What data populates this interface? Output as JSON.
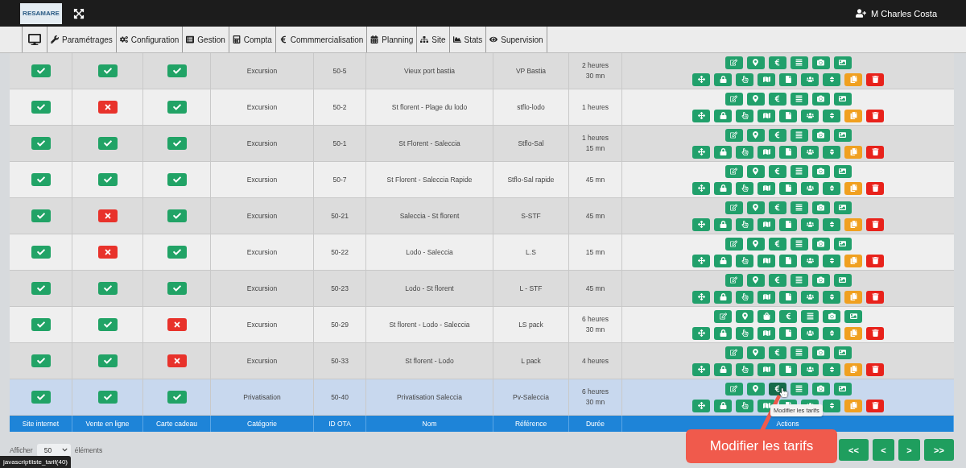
{
  "top_bar": {
    "logo": "RESAMARE",
    "user": "M Charles Costa"
  },
  "menu": [
    {
      "kind": "desktop"
    },
    {
      "kind": "wrench",
      "label": "Paramétrages"
    },
    {
      "kind": "cogs",
      "label": "Configuration"
    },
    {
      "kind": "list",
      "label": "Gestion"
    },
    {
      "kind": "calculator",
      "label": "Compta"
    },
    {
      "kind": "euro",
      "label": "Commmercialisation"
    },
    {
      "kind": "calendar",
      "label": "Planning"
    },
    {
      "kind": "sitemap",
      "label": "Site"
    },
    {
      "kind": "chart",
      "label": "Stats"
    },
    {
      "kind": "eye",
      "label": "Supervision"
    }
  ],
  "table": {
    "columns": [
      "Site internet",
      "Vente en ligne",
      "Carte cadeau",
      "Catégorie",
      "ID OTA",
      "Nom",
      "Référence",
      "Durée",
      "Actions"
    ],
    "rows": [
      {
        "selected": false,
        "site_internet": true,
        "vente_en_ligne": true,
        "carte_cadeau": true,
        "categorie": "Excursion",
        "id_ota": "50-5",
        "nom": "Vieux port bastia",
        "reference": "VP Bastia",
        "duree": "2 heures\n30 mn",
        "actions_top": [
          {
            "kind": "edit",
            "hovered": false
          },
          {
            "kind": "pin",
            "hovered": false
          },
          {
            "kind": "euro",
            "hovered": false
          },
          {
            "kind": "list",
            "hovered": false
          },
          {
            "kind": "camera",
            "hovered": false
          },
          {
            "kind": "image",
            "hovered": false
          }
        ]
      },
      {
        "selected": false,
        "site_internet": true,
        "vente_en_ligne": false,
        "carte_cadeau": true,
        "categorie": "Excursion",
        "id_ota": "50-2",
        "nom": "St florent - Plage du lodo",
        "reference": "stflo-lodo",
        "duree": "1 heures",
        "actions_top": [
          {
            "kind": "edit",
            "hovered": false
          },
          {
            "kind": "pin",
            "hovered": false
          },
          {
            "kind": "euro",
            "hovered": false
          },
          {
            "kind": "list",
            "hovered": false
          },
          {
            "kind": "camera",
            "hovered": false
          },
          {
            "kind": "image",
            "hovered": false
          }
        ]
      },
      {
        "selected": false,
        "site_internet": true,
        "vente_en_ligne": true,
        "carte_cadeau": true,
        "categorie": "Excursion",
        "id_ota": "50-1",
        "nom": "St Florent - Saleccia",
        "reference": "Stflo-Sal",
        "duree": "1 heures\n15 mn",
        "actions_top": [
          {
            "kind": "edit",
            "hovered": false
          },
          {
            "kind": "pin",
            "hovered": false
          },
          {
            "kind": "euro",
            "hovered": false
          },
          {
            "kind": "list",
            "hovered": false
          },
          {
            "kind": "camera",
            "hovered": false
          },
          {
            "kind": "image",
            "hovered": false
          }
        ]
      },
      {
        "selected": false,
        "site_internet": true,
        "vente_en_ligne": true,
        "carte_cadeau": true,
        "categorie": "Excursion",
        "id_ota": "50-7",
        "nom": "St Florent - Saleccia Rapide",
        "reference": "Stflo-Sal rapide",
        "duree": "45 mn",
        "actions_top": [
          {
            "kind": "edit",
            "hovered": false
          },
          {
            "kind": "pin",
            "hovered": false
          },
          {
            "kind": "euro",
            "hovered": false
          },
          {
            "kind": "list",
            "hovered": false
          },
          {
            "kind": "camera",
            "hovered": false
          },
          {
            "kind": "image",
            "hovered": false
          }
        ]
      },
      {
        "selected": false,
        "site_internet": true,
        "vente_en_ligne": false,
        "carte_cadeau": true,
        "categorie": "Excursion",
        "id_ota": "50-21",
        "nom": "Saleccia - St florent",
        "reference": "S-STF",
        "duree": "45 mn",
        "actions_top": [
          {
            "kind": "edit",
            "hovered": false
          },
          {
            "kind": "pin",
            "hovered": false
          },
          {
            "kind": "euro",
            "hovered": false
          },
          {
            "kind": "list",
            "hovered": false
          },
          {
            "kind": "camera",
            "hovered": false
          },
          {
            "kind": "image",
            "hovered": false
          }
        ]
      },
      {
        "selected": false,
        "site_internet": true,
        "vente_en_ligne": false,
        "carte_cadeau": true,
        "categorie": "Excursion",
        "id_ota": "50-22",
        "nom": "Lodo - Saleccia",
        "reference": "L.S",
        "duree": "15 mn",
        "actions_top": [
          {
            "kind": "edit",
            "hovered": false
          },
          {
            "kind": "pin",
            "hovered": false
          },
          {
            "kind": "euro",
            "hovered": false
          },
          {
            "kind": "list",
            "hovered": false
          },
          {
            "kind": "camera",
            "hovered": false
          },
          {
            "kind": "image",
            "hovered": false
          }
        ]
      },
      {
        "selected": false,
        "site_internet": true,
        "vente_en_ligne": true,
        "carte_cadeau": true,
        "categorie": "Excursion",
        "id_ota": "50-23",
        "nom": "Lodo - St florent",
        "reference": "L - STF",
        "duree": "45 mn",
        "actions_top": [
          {
            "kind": "edit",
            "hovered": false
          },
          {
            "kind": "pin",
            "hovered": false
          },
          {
            "kind": "euro",
            "hovered": false
          },
          {
            "kind": "list",
            "hovered": false
          },
          {
            "kind": "camera",
            "hovered": false
          },
          {
            "kind": "image",
            "hovered": false
          }
        ]
      },
      {
        "selected": false,
        "site_internet": true,
        "vente_en_ligne": true,
        "carte_cadeau": false,
        "categorie": "Excursion",
        "id_ota": "50-29",
        "nom": "St florent - Lodo - Saleccia",
        "reference": "LS pack",
        "duree": "6 heures\n30 mn",
        "actions_top": [
          {
            "kind": "edit",
            "hovered": false
          },
          {
            "kind": "pin",
            "hovered": false
          },
          {
            "kind": "bag",
            "hovered": false
          },
          {
            "kind": "euro",
            "hovered": false
          },
          {
            "kind": "list",
            "hovered": false
          },
          {
            "kind": "camera",
            "hovered": false
          },
          {
            "kind": "image",
            "hovered": false
          }
        ]
      },
      {
        "selected": false,
        "site_internet": true,
        "vente_en_ligne": true,
        "carte_cadeau": false,
        "categorie": "Excursion",
        "id_ota": "50-33",
        "nom": "St florent - Lodo",
        "reference": "L pack",
        "duree": "4 heures",
        "actions_top": [
          {
            "kind": "edit",
            "hovered": false
          },
          {
            "kind": "pin",
            "hovered": false
          },
          {
            "kind": "euro",
            "hovered": false
          },
          {
            "kind": "list",
            "hovered": false
          },
          {
            "kind": "camera",
            "hovered": false
          },
          {
            "kind": "image",
            "hovered": false
          }
        ]
      },
      {
        "selected": true,
        "site_internet": true,
        "vente_en_ligne": true,
        "carte_cadeau": true,
        "categorie": "Privatisation",
        "id_ota": "50-40",
        "nom": "Privatisation Saleccia",
        "reference": "Pv-Saleccia",
        "duree": "6 heures\n30 mn",
        "actions_top": [
          {
            "kind": "edit",
            "hovered": false
          },
          {
            "kind": "pin",
            "hovered": false
          },
          {
            "kind": "euro",
            "hovered": true
          },
          {
            "kind": "list",
            "hovered": false
          },
          {
            "kind": "camera",
            "hovered": false
          },
          {
            "kind": "image",
            "hovered": false
          }
        ]
      }
    ],
    "actions_bottom": [
      {
        "kind": "move"
      },
      {
        "kind": "lock"
      },
      {
        "kind": "hand"
      },
      {
        "kind": "map"
      },
      {
        "kind": "file"
      },
      {
        "kind": "users"
      },
      {
        "kind": "sort"
      },
      {
        "kind": "copy"
      },
      {
        "kind": "trash"
      }
    ]
  },
  "tooltip": "Modifier les tarifs",
  "callout": "Modifier les tarifs",
  "footer": {
    "show_label": "Afficher",
    "page_size": "50",
    "items_label": "éléments",
    "pagination": [
      "<<",
      "<",
      ">",
      ">>"
    ]
  },
  "status_bar": "javascriptliste_tarif(40)"
}
